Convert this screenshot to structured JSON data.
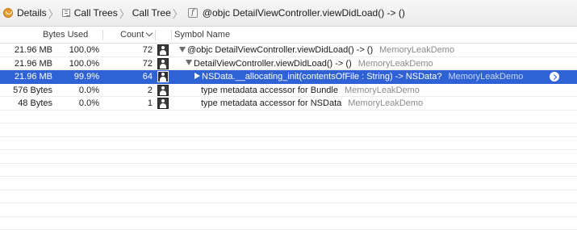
{
  "breadcrumb": {
    "items": [
      {
        "label": "Details",
        "icon": "details-icon"
      },
      {
        "label": "Call Trees",
        "icon": "call-tree-icon"
      },
      {
        "label": "Call Tree",
        "icon": null
      },
      {
        "label": "@objc DetailViewController.viewDidLoad() -> ()",
        "icon": "function-icon"
      }
    ]
  },
  "columns": {
    "bytes_used": "Bytes Used",
    "count": "Count",
    "symbol_name": "Symbol Name"
  },
  "rows": [
    {
      "bytes": "21.96 MB",
      "percent": "100.0%",
      "count": "72",
      "disclosure": "down",
      "indent": 0,
      "symbol": "@objc DetailViewController.viewDidLoad() -> ()",
      "library": "MemoryLeakDemo",
      "selected": false
    },
    {
      "bytes": "21.96 MB",
      "percent": "100.0%",
      "count": "72",
      "disclosure": "down",
      "indent": 1,
      "symbol": "DetailViewController.viewDidLoad() -> ()",
      "library": "MemoryLeakDemo",
      "selected": false
    },
    {
      "bytes": "21.96 MB",
      "percent": "99.9%",
      "count": "64",
      "disclosure": "right",
      "indent": 2,
      "symbol": "NSData.__allocating_init(contentsOfFile : String) -> NSData?",
      "library": "MemoryLeakDemo",
      "selected": true
    },
    {
      "bytes": "576 Bytes",
      "percent": "0.0%",
      "count": "2",
      "disclosure": "none",
      "indent": 3,
      "symbol": "type metadata accessor for Bundle",
      "library": "MemoryLeakDemo",
      "selected": false
    },
    {
      "bytes": "48 Bytes",
      "percent": "0.0%",
      "count": "1",
      "disclosure": "none",
      "indent": 3,
      "symbol": "type metadata accessor for NSData",
      "library": "MemoryLeakDemo",
      "selected": false
    }
  ],
  "colors": {
    "selection": "#2f62d5",
    "library_text": "#8a8a8a"
  }
}
